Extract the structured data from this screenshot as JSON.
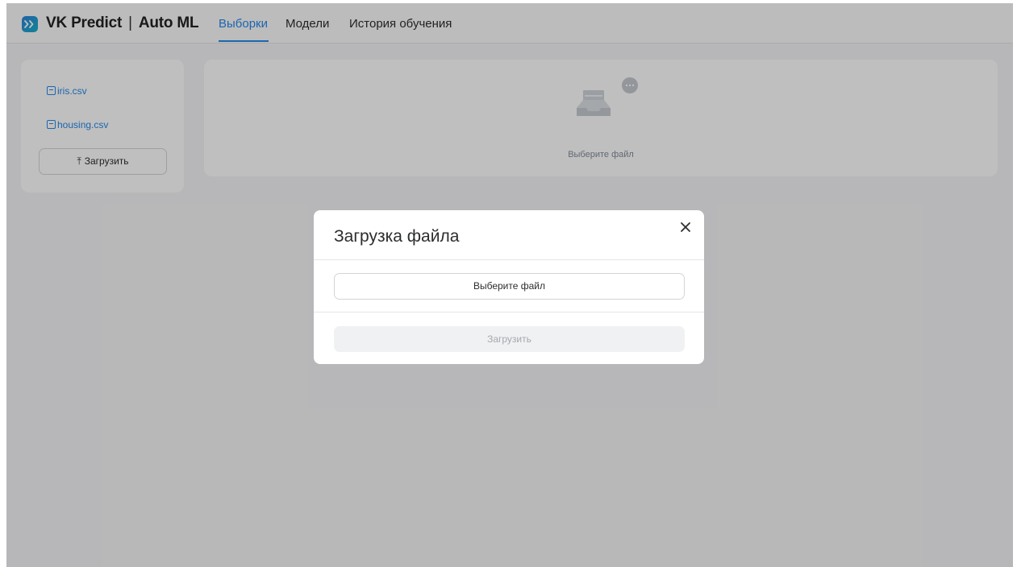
{
  "header": {
    "brand_name": "VK Predict",
    "brand_separator": "|",
    "brand_product": "Auto ML",
    "tabs": [
      {
        "label": "Выборки",
        "active": true
      },
      {
        "label": "Модели",
        "active": false
      },
      {
        "label": "История обучения",
        "active": false
      }
    ],
    "accent_color": "#2688eb"
  },
  "sidebar": {
    "files": [
      {
        "name": "iris.csv",
        "icon": "file-icon"
      },
      {
        "name": "housing.csv",
        "icon": "file-icon"
      }
    ],
    "upload_label": "Загрузить",
    "upload_icon": "upload-arrow-icon"
  },
  "main": {
    "empty_state_text": "Выберите файл",
    "empty_state_icon": "inbox-chat-icon"
  },
  "modal": {
    "title": "Загрузка файла",
    "choose_file_label": "Выберите файл",
    "submit_label": "Загрузить",
    "submit_disabled": true,
    "close_icon": "close-icon"
  }
}
